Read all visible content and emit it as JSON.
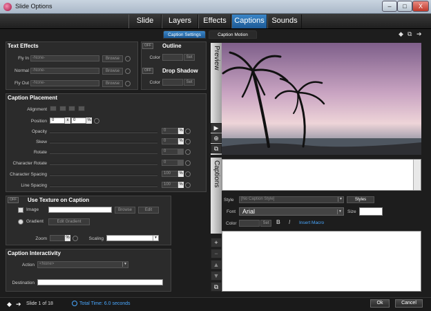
{
  "window": {
    "title": "Slide Options",
    "min": "–",
    "max": "□",
    "close": "X"
  },
  "tabs": [
    {
      "label": "Slide"
    },
    {
      "label": "Layers"
    },
    {
      "label": "Effects"
    },
    {
      "label": "Captions"
    },
    {
      "label": "Sounds"
    }
  ],
  "active_tab": "Captions",
  "subtabs": [
    {
      "label": "Caption Settings"
    },
    {
      "label": "Caption Motion"
    }
  ],
  "nav": {
    "prev": "◆",
    "copy": "⧉",
    "next": "➔"
  },
  "text_effects": {
    "title": "Text Effects",
    "rows": [
      {
        "label": "Fly In",
        "value": "-None-",
        "button": "Browse"
      },
      {
        "label": "Normal",
        "value": "-None-",
        "button": "Browse"
      },
      {
        "label": "Fly Out",
        "value": "-None-",
        "button": "Browse"
      }
    ]
  },
  "outline": {
    "toggle": "OFF",
    "title": "Outline",
    "color_label": "Color",
    "set": "Set"
  },
  "drop_shadow": {
    "toggle": "OFF",
    "title": "Drop Shadow",
    "color_label": "Color",
    "set": "Set"
  },
  "placement": {
    "title": "Caption Placement",
    "alignment_label": "Alignment",
    "position_label": "Position",
    "position_x": "0",
    "position_sep": "x",
    "position_y": "0",
    "pct": "%",
    "sliders": [
      {
        "label": "Opacity",
        "value": "0"
      },
      {
        "label": "Skew",
        "value": "0"
      },
      {
        "label": "Rotate",
        "value": "0"
      },
      {
        "label": "Character Rotate",
        "value": "0"
      },
      {
        "label": "Character Spacing",
        "value": "100"
      },
      {
        "label": "Line Spacing",
        "value": "100"
      }
    ]
  },
  "texture": {
    "toggle": "OFF",
    "title": "Use Texture on Caption",
    "image_label": "Image",
    "browse": "Browse",
    "edit": "Edit",
    "gradient_label": "Gradient",
    "edit_gradient": "Edit Gradient",
    "zoom_label": "Zoom",
    "scaling_label": "Scaling"
  },
  "interactivity": {
    "title": "Caption Interactivity",
    "action_label": "Action",
    "action_value": "<None>",
    "destination_label": "Destination"
  },
  "preview": {
    "label": "Preview"
  },
  "captions": {
    "label": "Captions"
  },
  "caption_style": {
    "style_label": "Style",
    "style_value": "[No Caption Style]",
    "styles_button": "Styles",
    "font_label": "Font",
    "font_value": "Arial",
    "size_label": "Size",
    "color_label": "Color",
    "set": "Set",
    "bold": "B",
    "italic": "I",
    "insert_macro": "Insert Macro"
  },
  "footer": {
    "slide_text": "Slide 1 of 18",
    "total_time": "Total Time: 6.0 seconds",
    "ok": "Ok",
    "cancel": "Cancel"
  }
}
